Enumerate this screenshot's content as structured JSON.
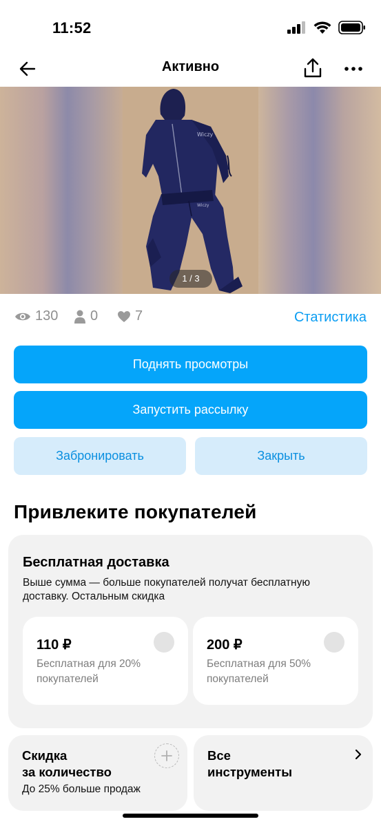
{
  "status_bar": {
    "time": "11:52"
  },
  "nav": {
    "title": "Активно"
  },
  "gallery": {
    "counter": "1 / 3",
    "photo_label": "Wiczy"
  },
  "stats": {
    "views": "130",
    "contacts": "0",
    "favorites": "7",
    "link": "Статистика"
  },
  "actions": {
    "boost": "Поднять просмотры",
    "mailing": "Запустить рассылку",
    "reserve": "Забронировать",
    "close": "Закрыть"
  },
  "attract": {
    "title": "Привлеките покупателей",
    "free_delivery": {
      "title": "Бесплатная доставка",
      "description": "Выше сумма — больше покупателей получат бесплатную доставку. Остальным скидка",
      "options": [
        {
          "price": "110 ₽",
          "note": "Бесплатная для 20% покупателей"
        },
        {
          "price": "200 ₽",
          "note": "Бесплатная для 50% покупателей"
        }
      ]
    },
    "quantity_discount": {
      "title_line1": "Скидка",
      "title_line2": "за количество",
      "subtitle": "До 25% больше продаж"
    },
    "all_tools": {
      "title_line1": "Все",
      "title_line2": "инструменты"
    }
  },
  "colors": {
    "accent": "#05a5fa",
    "accent_light": "#d6ecfb",
    "link": "#0a9df2",
    "card_bg": "#f2f2f2"
  },
  "icons": [
    "cellular-icon",
    "wifi-icon",
    "battery-icon",
    "back-arrow-icon",
    "share-icon",
    "more-icon",
    "eye-icon",
    "person-icon",
    "heart-icon",
    "plus-icon",
    "chevron-right-icon"
  ]
}
